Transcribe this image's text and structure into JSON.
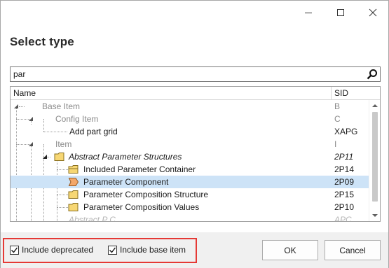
{
  "window": {
    "heading": "Select type",
    "controls": {
      "minimize": "minimize",
      "maximize": "maximize",
      "close": "close"
    }
  },
  "search": {
    "value": "par",
    "placeholder": ""
  },
  "table": {
    "columns": {
      "name": "Name",
      "sid": "SID"
    },
    "rows": [
      {
        "label": "Base Item",
        "sid": "B"
      },
      {
        "label": "Config Item",
        "sid": "C"
      },
      {
        "label": "Add part grid",
        "sid": "XAPG"
      },
      {
        "label": "Item",
        "sid": "I"
      },
      {
        "label": "Abstract Parameter Structures",
        "sid": "2P11"
      },
      {
        "label": "Included Parameter Container",
        "sid": "2P14"
      },
      {
        "label": "Parameter Component",
        "sid": "2P09"
      },
      {
        "label": "Parameter Composition Structure",
        "sid": "2P15"
      },
      {
        "label": "Parameter Composition Values",
        "sid": "2P10"
      },
      {
        "label": "Abstract P C",
        "sid": "APC"
      }
    ]
  },
  "footer": {
    "include_deprecated": {
      "label": "Include deprecated",
      "checked": true
    },
    "include_base_item": {
      "label": "Include base item",
      "checked": true
    },
    "ok_label": "OK",
    "cancel_label": "Cancel"
  },
  "colors": {
    "selected_row": "#cde3f7",
    "highlight_border": "#e53935",
    "folder": "#f7d774",
    "component_icon": "#f3a76a"
  }
}
